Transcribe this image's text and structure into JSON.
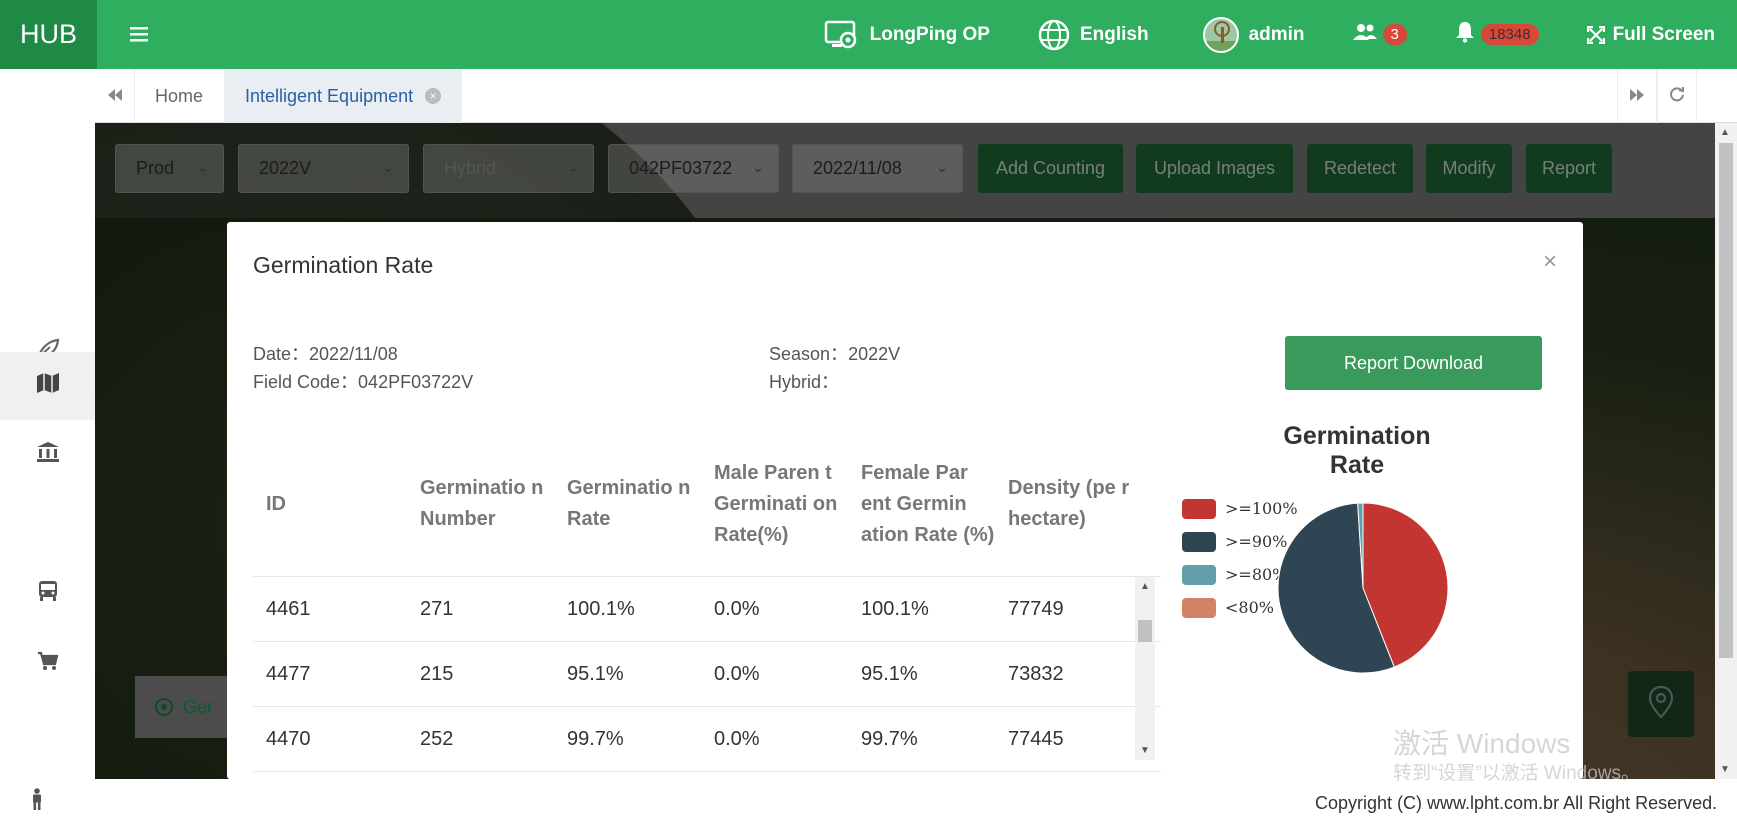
{
  "brand": "HUB",
  "top": {
    "org": "LongPing OP",
    "language": "English",
    "user": "admin",
    "groups_count": "3",
    "notifications_count": "18348",
    "fullscreen": "Full Screen"
  },
  "tabs": [
    {
      "label": "Home"
    },
    {
      "label": "Intelligent Equipment"
    }
  ],
  "filters": {
    "env": "Prod",
    "season": "2022V",
    "hybrid_placeholder": "Hybrid",
    "field": "042PF03722",
    "date": "2022/11/08",
    "buttons": [
      "Add Counting",
      "Upload Images",
      "Redetect",
      "Modify",
      "Report"
    ]
  },
  "map_legend": "Ger",
  "modal": {
    "title": "Germination Rate",
    "date_label": "Date：",
    "date_value": "2022/11/08",
    "field_code_label": "Field Code：",
    "field_code_value": "042PF03722V",
    "season_label": "Season：",
    "season_value": "2022V",
    "hybrid_label": "Hybrid：",
    "hybrid_value": "",
    "download_button": "Report Download",
    "table": {
      "headers": [
        "ID",
        "Germinatio n Number",
        "Germinatio n Rate",
        "Male Paren t Germinati on Rate(%)",
        "Female Par ent Germin ation Rate (%)",
        "Density (pe r hectare)"
      ],
      "rows": [
        [
          "4461",
          "271",
          "100.1%",
          "0.0%",
          "100.1%",
          "77749"
        ],
        [
          "4477",
          "215",
          "95.1%",
          "0.0%",
          "95.1%",
          "73832"
        ],
        [
          "4470",
          "252",
          "99.7%",
          "0.0%",
          "99.7%",
          "77445"
        ]
      ]
    }
  },
  "chart_data": {
    "type": "pie",
    "title": "Germination Rate",
    "legend_position": "left",
    "categories": [
      ">=100%",
      ">=90%",
      ">=80%",
      "<80%"
    ],
    "values": [
      44,
      55,
      1,
      0
    ],
    "colors": [
      "#c23531",
      "#2f4554",
      "#61a0a8",
      "#d48265"
    ]
  },
  "watermark": {
    "line1": "激活 Windows",
    "line2": "转到“设置”以激活 Windows。"
  },
  "footer": "Copyright (C) www.lpht.com.br All Right Reserved.",
  "icons": {
    "sidebar": [
      "leaf-icon",
      "map-icon",
      "bank-icon",
      "bus-icon",
      "cart-icon",
      "person-icon"
    ],
    "top": [
      "hamburger-icon",
      "org-settings-icon",
      "globe-icon",
      "users-icon",
      "bell-icon",
      "fullscreen-icon"
    ]
  }
}
